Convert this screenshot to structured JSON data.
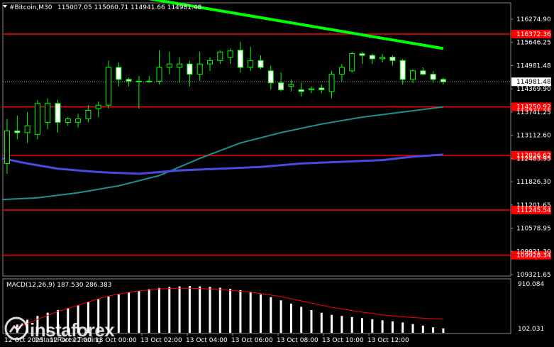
{
  "header": {
    "symbol": "#Bitcoin,M30",
    "ohlc": "115007.05 115060.71 114941.66 114981.48"
  },
  "watermark": {
    "brand": "instaforex",
    "tagline": "Instant Forex Trading"
  },
  "colors": {
    "background": "#000000",
    "bull_candle": "#00ff00",
    "bear_body": "#ffffff",
    "level_line": "#ff0000",
    "trend_line": "#00ff00",
    "ma_fast": "#1f8f8f",
    "ma_slow": "#4a4adf",
    "macd_signal": "#ff0000",
    "macd_hist": "#ffffff",
    "grid": "#888888"
  },
  "chart_data": [
    {
      "type": "candlestick",
      "ylim": [
        109322,
        117281
      ],
      "price_ticks": [
        "116274.90",
        "115646.25",
        "114981.48",
        "114369.90",
        "113741.25",
        "113112.60",
        "112483.95",
        "111826.30",
        "111201.65",
        "110578.95",
        "109921.30",
        "109321.65"
      ],
      "time_labels": [
        "12 Oct 2025",
        "12 Oct 22:00",
        "13 Oct 00:00",
        "13 Oct 02:00",
        "13 Oct 04:00",
        "13 Oct 06:00",
        "13 Oct 08:00",
        "13 Oct 10:00",
        "13 Oct 12:00"
      ],
      "levels": [
        {
          "label": "116372.36",
          "value": 116372.36
        },
        {
          "label": "114250.92",
          "value": 114250.92
        },
        {
          "label": "112836.62",
          "value": 112836.62
        },
        {
          "label": "111245.54",
          "value": 111245.54
        },
        {
          "label": "109928.34",
          "value": 109928.34
        }
      ],
      "current_price": {
        "label": "114981.48",
        "value": 114981.48
      },
      "candles": [
        {
          "o": 112600,
          "h": 113900,
          "l": 112300,
          "c": 113550
        },
        {
          "o": 113550,
          "h": 114000,
          "l": 113300,
          "c": 113500
        },
        {
          "o": 113500,
          "h": 114100,
          "l": 113200,
          "c": 113700
        },
        {
          "o": 113450,
          "h": 114450,
          "l": 113300,
          "c": 114350
        },
        {
          "o": 113800,
          "h": 114500,
          "l": 113600,
          "c": 114350
        },
        {
          "o": 114350,
          "h": 114450,
          "l": 113500,
          "c": 113800
        },
        {
          "o": 113800,
          "h": 113950,
          "l": 113700,
          "c": 113900
        },
        {
          "o": 113800,
          "h": 114050,
          "l": 113650,
          "c": 113900
        },
        {
          "o": 113900,
          "h": 114300,
          "l": 113800,
          "c": 114150
        },
        {
          "o": 114200,
          "h": 114400,
          "l": 113950,
          "c": 114300
        },
        {
          "o": 114300,
          "h": 115600,
          "l": 114200,
          "c": 115400
        },
        {
          "o": 115400,
          "h": 115550,
          "l": 114850,
          "c": 115050
        },
        {
          "o": 115050,
          "h": 115100,
          "l": 114850,
          "c": 115000
        },
        {
          "o": 115000,
          "h": 115150,
          "l": 114200,
          "c": 114980
        },
        {
          "o": 114980,
          "h": 115150,
          "l": 114950,
          "c": 115000
        },
        {
          "o": 115000,
          "h": 115900,
          "l": 114900,
          "c": 115400
        },
        {
          "o": 115400,
          "h": 115850,
          "l": 115200,
          "c": 115500
        },
        {
          "o": 115400,
          "h": 115700,
          "l": 114950,
          "c": 115500
        },
        {
          "o": 115500,
          "h": 115600,
          "l": 114850,
          "c": 115200
        },
        {
          "o": 115200,
          "h": 115850,
          "l": 115000,
          "c": 115500
        },
        {
          "o": 115500,
          "h": 115700,
          "l": 115300,
          "c": 115600
        },
        {
          "o": 115600,
          "h": 115900,
          "l": 115500,
          "c": 115850
        },
        {
          "o": 115700,
          "h": 115950,
          "l": 115500,
          "c": 115880
        },
        {
          "o": 115900,
          "h": 116150,
          "l": 115250,
          "c": 115400
        },
        {
          "o": 115400,
          "h": 116000,
          "l": 115300,
          "c": 115600
        },
        {
          "o": 115600,
          "h": 115750,
          "l": 115350,
          "c": 115400
        },
        {
          "o": 115300,
          "h": 115450,
          "l": 114750,
          "c": 114950
        },
        {
          "o": 114950,
          "h": 115250,
          "l": 114700,
          "c": 114750
        },
        {
          "o": 114850,
          "h": 115050,
          "l": 114700,
          "c": 114900
        },
        {
          "o": 114750,
          "h": 114950,
          "l": 114550,
          "c": 114700
        },
        {
          "o": 114750,
          "h": 114850,
          "l": 114650,
          "c": 114780
        },
        {
          "o": 114800,
          "h": 114900,
          "l": 114650,
          "c": 114750
        },
        {
          "o": 114700,
          "h": 115300,
          "l": 114500,
          "c": 115200
        },
        {
          "o": 115200,
          "h": 115500,
          "l": 115000,
          "c": 115400
        },
        {
          "o": 115300,
          "h": 115850,
          "l": 115250,
          "c": 115800
        },
        {
          "o": 115800,
          "h": 115850,
          "l": 115500,
          "c": 115750
        },
        {
          "o": 115750,
          "h": 115800,
          "l": 115500,
          "c": 115650
        },
        {
          "o": 115650,
          "h": 115800,
          "l": 115550,
          "c": 115700
        },
        {
          "o": 115700,
          "h": 115750,
          "l": 115450,
          "c": 115600
        },
        {
          "o": 115600,
          "h": 115650,
          "l": 114900,
          "c": 115050
        },
        {
          "o": 115050,
          "h": 115350,
          "l": 114950,
          "c": 115300
        },
        {
          "o": 115300,
          "h": 115400,
          "l": 115200,
          "c": 115200
        },
        {
          "o": 115200,
          "h": 115300,
          "l": 114950,
          "c": 115050
        },
        {
          "o": 115050,
          "h": 115100,
          "l": 114900,
          "c": 114981
        }
      ],
      "trend_line": [
        {
          "i": 13,
          "v": 117450
        },
        {
          "i": 43,
          "v": 115950
        }
      ],
      "ma_fast": [
        {
          "i": -0.5,
          "v": 111550
        },
        {
          "i": 3,
          "v": 111600
        },
        {
          "i": 7,
          "v": 111750
        },
        {
          "i": 11,
          "v": 111950
        },
        {
          "i": 15,
          "v": 112250
        },
        {
          "i": 19,
          "v": 112750
        },
        {
          "i": 23,
          "v": 113200
        },
        {
          "i": 27,
          "v": 113500
        },
        {
          "i": 31,
          "v": 113750
        },
        {
          "i": 35,
          "v": 113950
        },
        {
          "i": 39,
          "v": 114100
        },
        {
          "i": 43,
          "v": 114250
        }
      ],
      "ma_slow": [
        {
          "i": -0.5,
          "v": 112750
        },
        {
          "i": 2,
          "v": 112600
        },
        {
          "i": 5,
          "v": 112450
        },
        {
          "i": 9,
          "v": 112350
        },
        {
          "i": 13,
          "v": 112300
        },
        {
          "i": 17,
          "v": 112400
        },
        {
          "i": 21,
          "v": 112450
        },
        {
          "i": 25,
          "v": 112500
        },
        {
          "i": 29,
          "v": 112600
        },
        {
          "i": 33,
          "v": 112650
        },
        {
          "i": 37,
          "v": 112700
        },
        {
          "i": 40,
          "v": 112800
        },
        {
          "i": 43,
          "v": 112860
        }
      ]
    },
    {
      "type": "bar",
      "title": "MACD(12,26,9) 187.530 286.383",
      "ylim": [
        0,
        910.084
      ],
      "scale_labels": [
        "910.084",
        "102.031"
      ],
      "hist_values": [
        140,
        230,
        300,
        360,
        410,
        450,
        500,
        560,
        610,
        660,
        700,
        740,
        770,
        800,
        820,
        840,
        850,
        855,
        850,
        840,
        825,
        805,
        780,
        750,
        700,
        650,
        590,
        530,
        470,
        410,
        360,
        320,
        300,
        280,
        260,
        240,
        220,
        200,
        180,
        150,
        120,
        90,
        70
      ],
      "signal_values": [
        80,
        160,
        240,
        310,
        380,
        440,
        500,
        560,
        620,
        670,
        710,
        740,
        765,
        785,
        800,
        810,
        815,
        815,
        810,
        800,
        790,
        775,
        760,
        740,
        715,
        690,
        660,
        620,
        580,
        540,
        500,
        460,
        430,
        400,
        370,
        345,
        320,
        300,
        285,
        270,
        260,
        250,
        240
      ]
    }
  ]
}
